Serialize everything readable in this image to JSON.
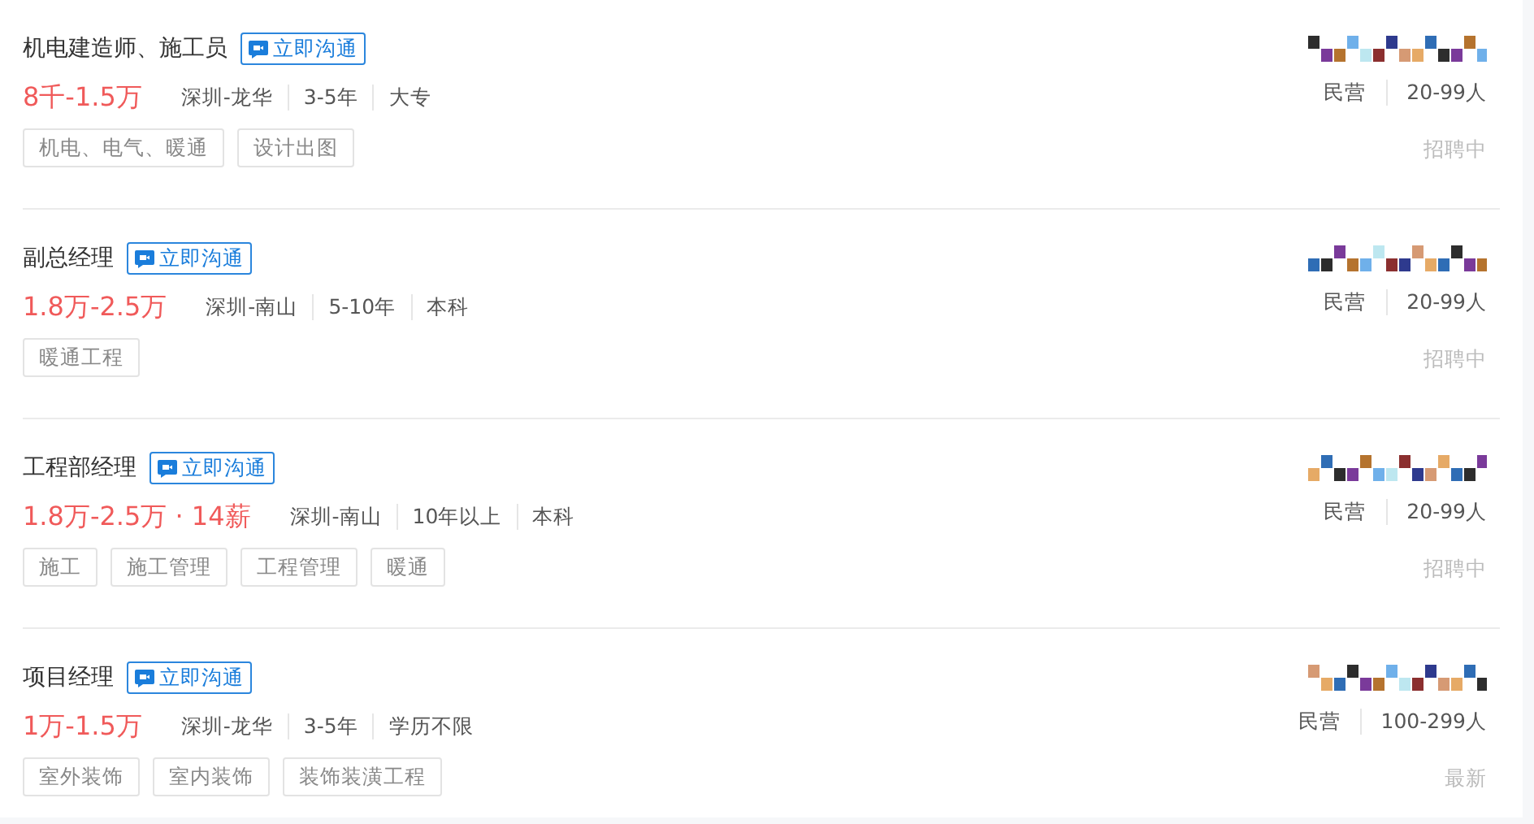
{
  "jobs": [
    {
      "title": "机电建造师、施工员",
      "chat_button": "立即沟通",
      "salary": "8千-1.5万",
      "meta": [
        "深圳-龙华",
        "3-5年",
        "大专"
      ],
      "tags": [
        "机电、电气、暖通",
        "设计出图"
      ],
      "company_info": [
        "民营",
        "20-99人"
      ],
      "status": "招聘中"
    },
    {
      "title": "副总经理",
      "chat_button": "立即沟通",
      "salary": "1.8万-2.5万",
      "meta": [
        "深圳-南山",
        "5-10年",
        "本科"
      ],
      "tags": [
        "暖通工程"
      ],
      "company_info": [
        "民营",
        "20-99人"
      ],
      "status": "招聘中"
    },
    {
      "title": "工程部经理",
      "chat_button": "立即沟通",
      "salary": "1.8万-2.5万 · 14薪",
      "meta": [
        "深圳-南山",
        "10年以上",
        "本科"
      ],
      "tags": [
        "施工",
        "施工管理",
        "工程管理",
        "暖通"
      ],
      "company_info": [
        "民营",
        "20-99人"
      ],
      "status": "招聘中"
    },
    {
      "title": "项目经理",
      "chat_button": "立即沟通",
      "salary": "1万-1.5万",
      "meta": [
        "深圳-龙华",
        "3-5年",
        "学历不限"
      ],
      "tags": [
        "室外装饰",
        "室内装饰",
        "装饰装潢工程"
      ],
      "company_info": [
        "民营",
        "100-299人"
      ],
      "status": "最新"
    }
  ]
}
